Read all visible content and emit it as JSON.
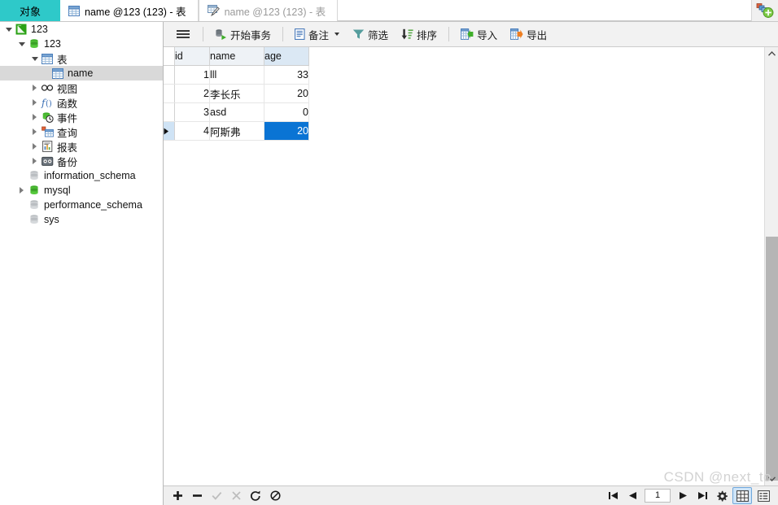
{
  "window": {
    "add_tab_icon": "new-tab-plus-icon"
  },
  "tabstrip": {
    "objects_tab": "对象",
    "tabs": [
      {
        "label": "name @123 (123) - 表",
        "icon": "table-icon",
        "state": "active"
      },
      {
        "label": "name @123 (123) - 表",
        "icon": "table-design-icon",
        "state": "inactive"
      }
    ]
  },
  "sidebar": {
    "tree": [
      {
        "label": "123",
        "icon": "connection-icon",
        "depth": 0,
        "arrow": "down",
        "selected": false
      },
      {
        "label": "123",
        "icon": "database-icon",
        "depth": 1,
        "arrow": "down",
        "selected": false
      },
      {
        "label": "表",
        "icon": "table-icon",
        "depth": 2,
        "arrow": "down",
        "selected": false
      },
      {
        "label": "name",
        "icon": "table-icon",
        "depth": 3,
        "arrow": "none",
        "selected": true
      },
      {
        "label": "视图",
        "icon": "view-icon",
        "depth": 2,
        "arrow": "right",
        "selected": false
      },
      {
        "label": "函数",
        "icon": "function-icon",
        "depth": 2,
        "arrow": "right",
        "selected": false
      },
      {
        "label": "事件",
        "icon": "event-icon",
        "depth": 2,
        "arrow": "right",
        "selected": false
      },
      {
        "label": "查询",
        "icon": "query-icon",
        "depth": 2,
        "arrow": "right",
        "selected": false
      },
      {
        "label": "报表",
        "icon": "report-icon",
        "depth": 2,
        "arrow": "right",
        "selected": false
      },
      {
        "label": "备份",
        "icon": "backup-icon",
        "depth": 2,
        "arrow": "right",
        "selected": false
      },
      {
        "label": "information_schema",
        "icon": "database-grey-icon",
        "depth": 1,
        "arrow": "none",
        "selected": false
      },
      {
        "label": "mysql",
        "icon": "database-icon",
        "depth": 1,
        "arrow": "right",
        "selected": false
      },
      {
        "label": "performance_schema",
        "icon": "database-grey-icon",
        "depth": 1,
        "arrow": "none",
        "selected": false
      },
      {
        "label": "sys",
        "icon": "database-grey-icon",
        "depth": 1,
        "arrow": "none",
        "selected": false
      }
    ]
  },
  "toolbar": {
    "menu_icon": "hamburger-icon",
    "begin_transaction": "开始事务",
    "note": "备注",
    "filter": "筛选",
    "sort": "排序",
    "import": "导入",
    "export": "导出"
  },
  "grid": {
    "columns": [
      "id",
      "name",
      "age"
    ],
    "selected_column": "age",
    "rows": [
      {
        "id": "1",
        "name": "lll",
        "age": "33",
        "current": false
      },
      {
        "id": "2",
        "name": "李长乐",
        "age": "20",
        "current": false
      },
      {
        "id": "3",
        "name": "asd",
        "age": "0",
        "current": false
      },
      {
        "id": "4",
        "name": "阿斯弗",
        "age": "20",
        "current": true
      }
    ],
    "selected_cell": {
      "row": 4,
      "column": "age",
      "value": "20"
    }
  },
  "statusbar": {
    "add_icon": "plus-icon",
    "remove_icon": "minus-icon",
    "apply_icon": "check-icon",
    "cancel_icon": "cross-icon",
    "refresh_icon": "refresh-icon",
    "stop_icon": "stop-icon",
    "first_icon": "first-page-icon",
    "prev_icon": "prev-page-icon",
    "page_value": "1",
    "next_icon": "next-page-icon",
    "last_icon": "last-page-icon",
    "settings_icon": "gear-icon",
    "grid_view_icon": "grid-view-icon",
    "form_view_icon": "form-view-icon"
  },
  "watermark": {
    "text": "CSDN @next_to"
  },
  "colors": {
    "accent_teal": "#2ec9c9",
    "selection_blue": "#0a74d4",
    "tree_selection": "#d9d9d9",
    "header_bg": "#eef2f6"
  }
}
